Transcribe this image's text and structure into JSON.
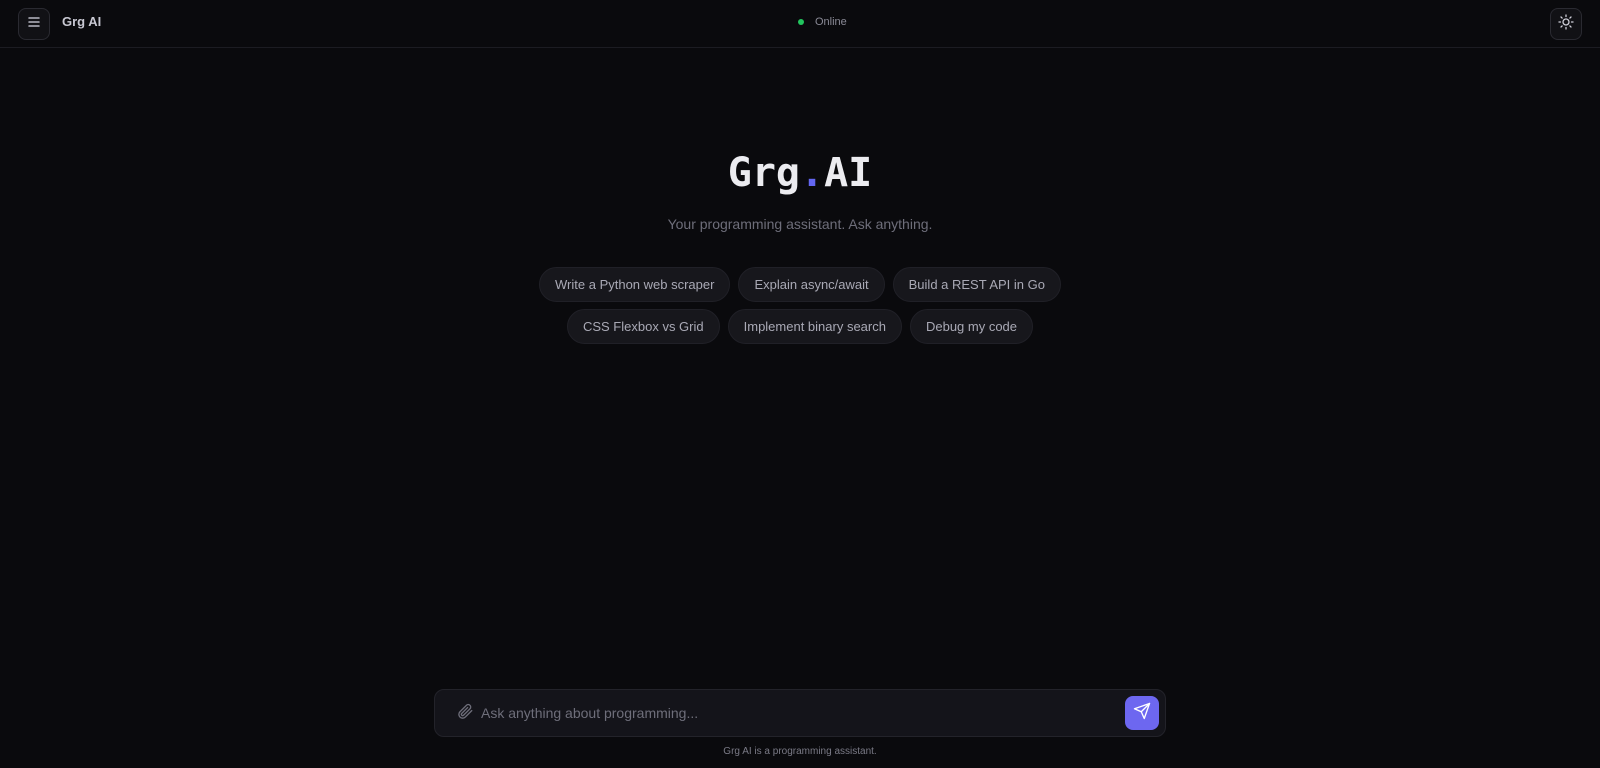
{
  "header": {
    "menu_icon": "hamburger-menu-icon",
    "brand": "Grg AI",
    "status_text": "Online",
    "status_color": "#22c55e",
    "theme_icon": "sun-icon"
  },
  "hero": {
    "title_main": "Grg",
    "title_dot": ".",
    "title_suffix": "AI",
    "accent_color": "#6366f1",
    "subtitle": "Your programming assistant. Ask anything."
  },
  "suggestions": [
    "Write a Python web scraper",
    "Explain async/await",
    "Build a REST API in Go",
    "CSS Flexbox vs Grid",
    "Implement binary search",
    "Debug my code"
  ],
  "composer": {
    "placeholder": "Ask anything about programming...",
    "value": "",
    "attach_icon": "paperclip-icon",
    "send_icon": "send-icon",
    "send_color": "#6d67f0"
  },
  "footer": {
    "note": "Grg AI is a programming assistant."
  }
}
